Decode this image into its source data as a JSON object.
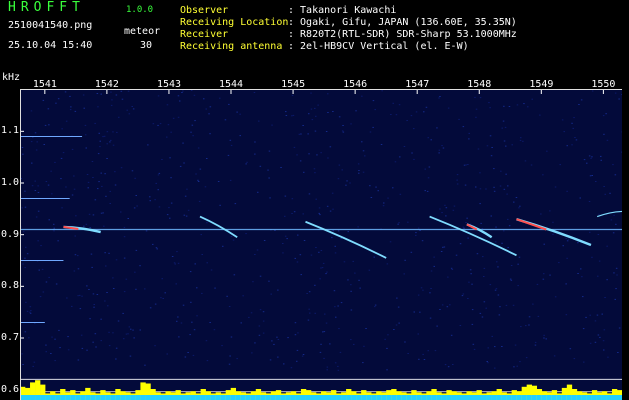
{
  "header": {
    "app_title": "HROFFT",
    "app_version": "1.0.0",
    "file_name": "2510041540.png",
    "timestamp": "25.10.04 15:40",
    "mode_label": "meteor",
    "mode_value": "30",
    "info": [
      {
        "label": "Observer",
        "value": ": Takanori Kawachi"
      },
      {
        "label": "Receiving Location",
        "value": ": Ogaki, Gifu, JAPAN (136.60E, 35.35N)"
      },
      {
        "label": "Receiver",
        "value": ": R820T2(RTL-SDR) SDR-Sharp 53.1000MHz"
      },
      {
        "label": "Receiving antenna",
        "value": ": 2el-HB9CV Vertical (el. E-W)"
      }
    ]
  },
  "colors": {
    "background": "#000000",
    "plot_background": "#030a3a",
    "title_green": "#39ff3c",
    "label_yellow": "#ffff33",
    "echo_cyan": "#7fdcff",
    "echo_red": "#ff5050",
    "bar_yellow": "#ffff00",
    "bar_cyan": "#22d0ff"
  },
  "chart_data": {
    "type": "heatmap",
    "yunit": "kHz",
    "x_ticks": [
      "1541",
      "1542",
      "1543",
      "1544",
      "1545",
      "1546",
      "1547",
      "1548",
      "1549",
      "1550"
    ],
    "y_ticks": [
      "1.1",
      "1.0",
      "0.9",
      "0.8",
      "0.7",
      "0.6"
    ],
    "x_range": [
      1540.6,
      1550.3
    ],
    "y_range": [
      0.58,
      1.18
    ],
    "carrier_khz": 0.91,
    "steady_lines": [
      {
        "khz": 1.09,
        "x_start": 1540.6,
        "x_end": 1541.6
      },
      {
        "khz": 0.97,
        "x_start": 1540.6,
        "x_end": 1541.4
      },
      {
        "khz": 0.85,
        "x_start": 1540.6,
        "x_end": 1541.3
      },
      {
        "khz": 0.73,
        "x_start": 1540.6,
        "x_end": 1541.0
      }
    ],
    "meteor_echoes": [
      {
        "x_start": 1541.3,
        "x_end": 1541.9,
        "khz_start": 0.915,
        "khz_end": 0.905,
        "intensity": "strong"
      },
      {
        "x_start": 1543.5,
        "x_end": 1544.1,
        "khz_start": 0.935,
        "khz_end": 0.895,
        "intensity": "medium"
      },
      {
        "x_start": 1545.2,
        "x_end": 1546.5,
        "khz_start": 0.925,
        "khz_end": 0.855,
        "intensity": "medium"
      },
      {
        "x_start": 1547.2,
        "x_end": 1548.6,
        "khz_start": 0.935,
        "khz_end": 0.86,
        "intensity": "medium"
      },
      {
        "x_start": 1547.8,
        "x_end": 1548.2,
        "khz_start": 0.92,
        "khz_end": 0.895,
        "intensity": "strong"
      },
      {
        "x_start": 1548.6,
        "x_end": 1549.8,
        "khz_start": 0.93,
        "khz_end": 0.88,
        "intensity": "strong"
      },
      {
        "x_start": 1549.9,
        "x_end": 1550.3,
        "khz_start": 0.935,
        "khz_end": 0.945,
        "intensity": "weak"
      }
    ],
    "signal_level_bars": [
      0.6,
      0.55,
      0.8,
      0.9,
      0.7,
      0.3,
      0.4,
      0.3,
      0.5,
      0.35,
      0.45,
      0.3,
      0.4,
      0.55,
      0.35,
      0.3,
      0.45,
      0.35,
      0.3,
      0.5,
      0.4,
      0.35,
      0.3,
      0.45,
      0.8,
      0.75,
      0.5,
      0.35,
      0.3,
      0.4,
      0.35,
      0.45,
      0.3,
      0.35,
      0.4,
      0.3,
      0.5,
      0.4,
      0.3,
      0.35,
      0.3,
      0.45,
      0.55,
      0.4,
      0.35,
      0.3,
      0.4,
      0.5,
      0.35,
      0.3,
      0.4,
      0.45,
      0.3,
      0.35,
      0.4,
      0.3,
      0.5,
      0.45,
      0.35,
      0.3,
      0.4,
      0.35,
      0.45,
      0.3,
      0.35,
      0.5,
      0.4,
      0.3,
      0.45,
      0.35,
      0.3,
      0.4,
      0.35,
      0.45,
      0.5,
      0.4,
      0.35,
      0.3,
      0.45,
      0.35,
      0.3,
      0.4,
      0.5,
      0.35,
      0.3,
      0.45,
      0.4,
      0.35,
      0.3,
      0.4,
      0.35,
      0.45,
      0.3,
      0.35,
      0.4,
      0.5,
      0.35,
      0.3,
      0.45,
      0.4,
      0.6,
      0.7,
      0.65,
      0.5,
      0.4,
      0.35,
      0.45,
      0.3,
      0.55,
      0.7,
      0.5,
      0.4,
      0.35,
      0.3,
      0.45,
      0.35,
      0.4,
      0.3,
      0.5,
      0.45
    ]
  }
}
